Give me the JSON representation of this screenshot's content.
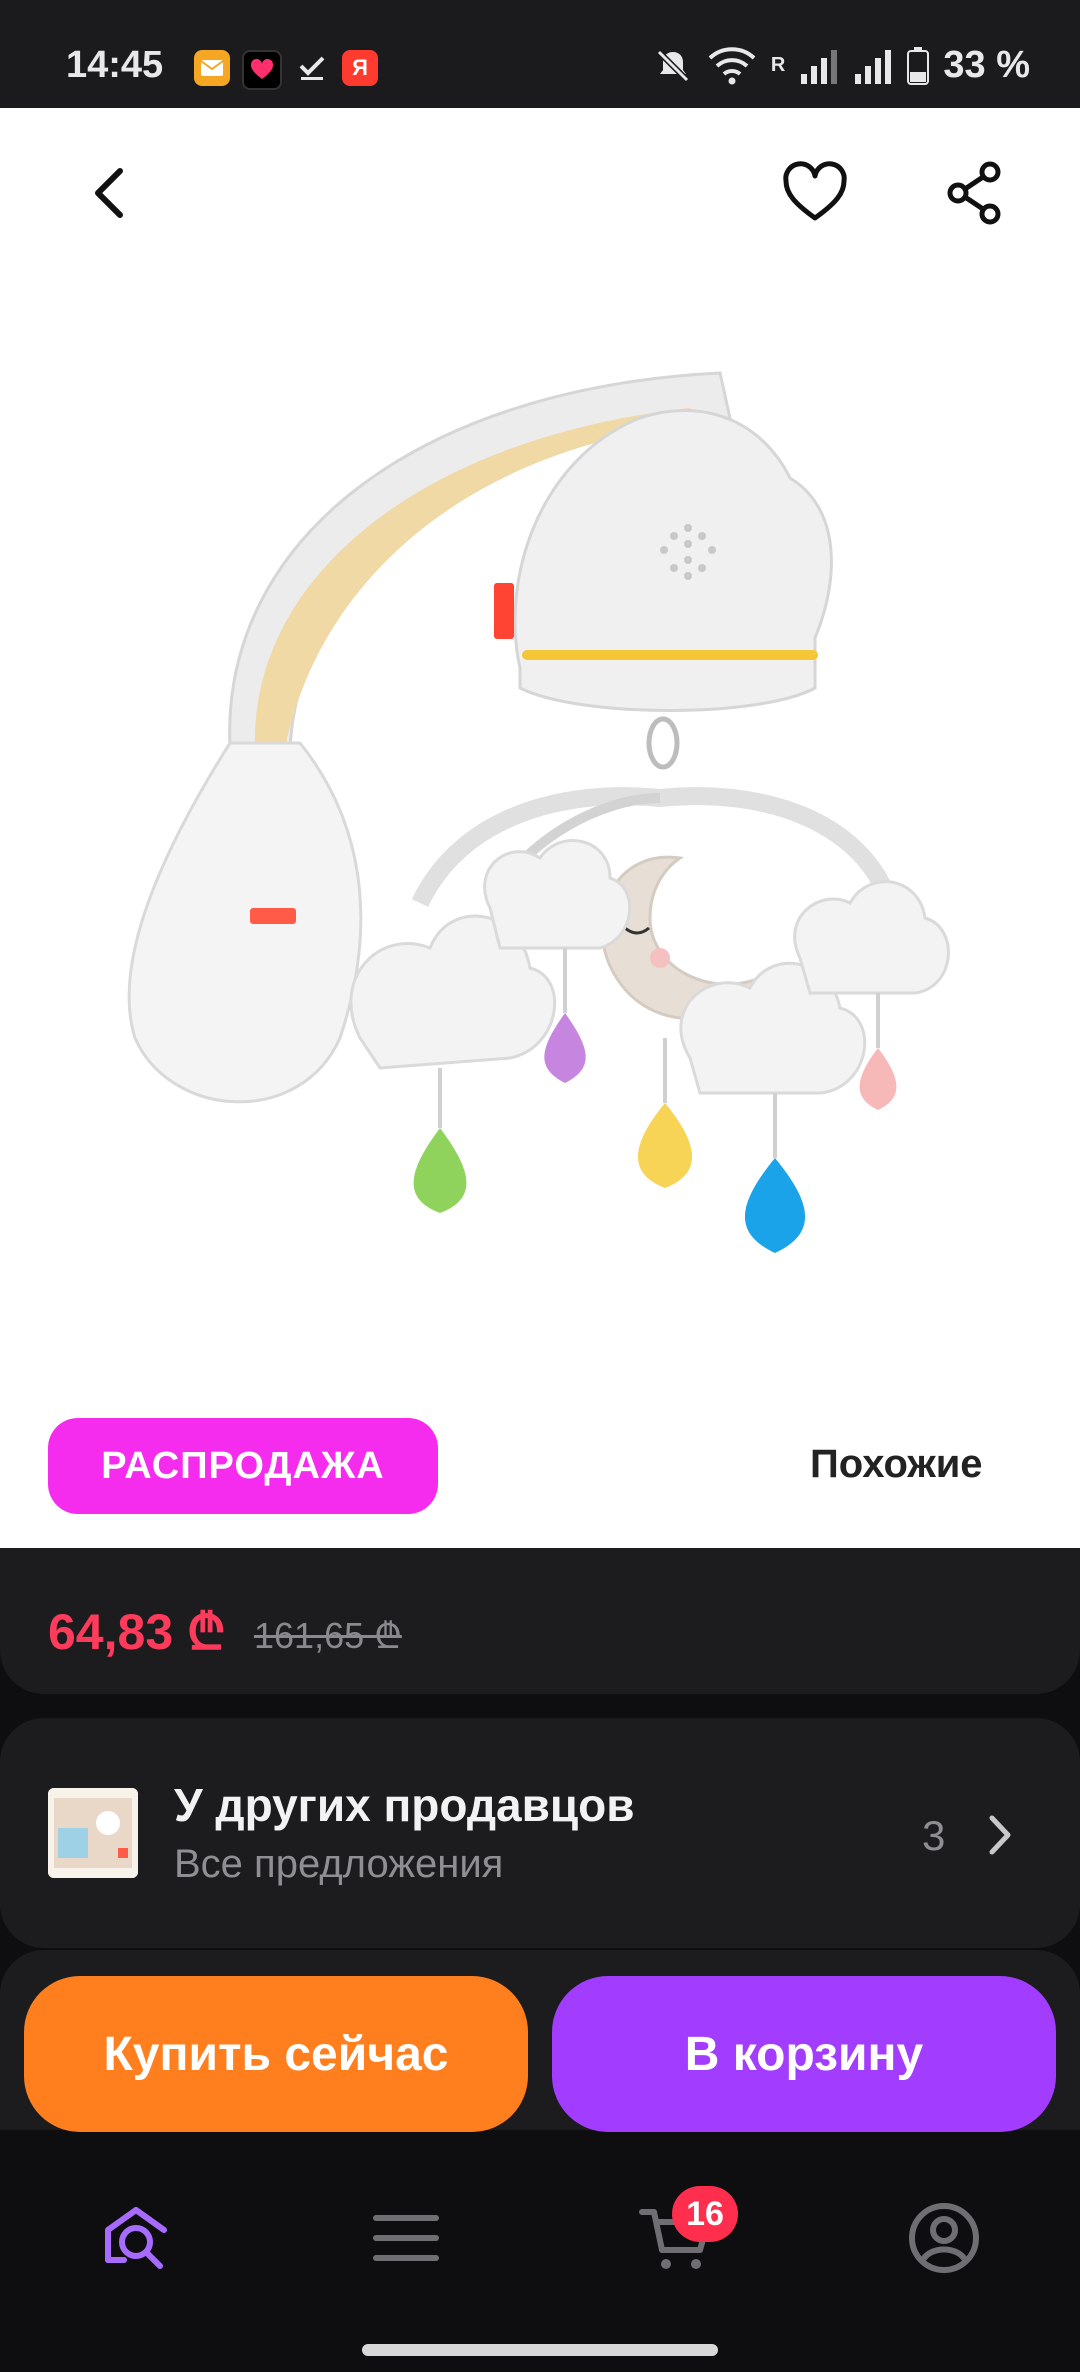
{
  "status_bar": {
    "time": "14:45",
    "app_icons": [
      "mail-app-icon",
      "heart-app-icon",
      "check-app-icon",
      "yandex-app-icon"
    ],
    "yandex_letter": "Я",
    "network_roaming": "R",
    "battery": "33 %"
  },
  "header": {
    "back_icon": "chevron-left-icon",
    "favorite_icon": "heart-icon",
    "share_icon": "share-icon"
  },
  "product": {
    "badge": "РАСПРОДАЖА",
    "similar_label": "Похожие",
    "price_current": "64,83 ₾",
    "price_old": "161,65 ₾"
  },
  "sellers": {
    "title": "У других продавцов",
    "subtitle": "Все предложения",
    "count": "3"
  },
  "actions": {
    "buy_now": "Купить сейчас",
    "add_to_cart": "В корзину"
  },
  "bottom_nav": {
    "items": [
      "home-search-icon",
      "catalog-menu-icon",
      "cart-icon",
      "profile-icon"
    ],
    "cart_count": "16"
  },
  "colors": {
    "accent_sale": "#f52bee",
    "price_red": "#ff3b5c",
    "buy_orange": "#ff7f1f",
    "cart_purple": "#a23cff",
    "nav_active": "#a86bff"
  }
}
